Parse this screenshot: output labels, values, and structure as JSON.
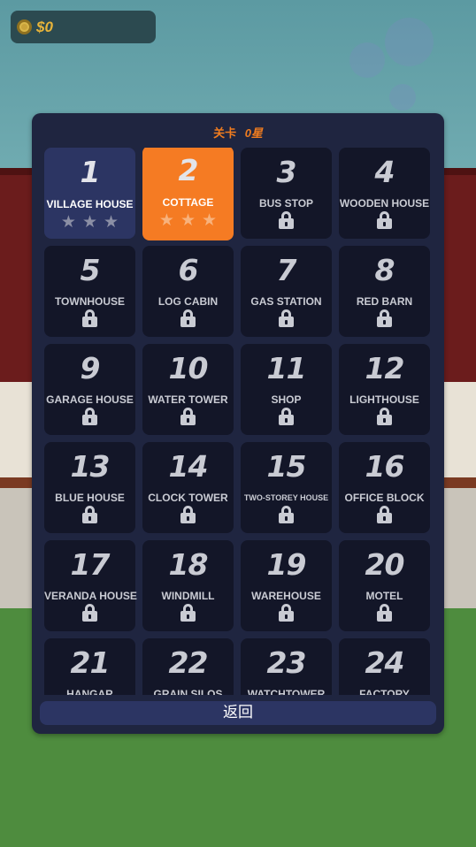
{
  "hud": {
    "coins": "$0",
    "coin_icon": "coin-icon"
  },
  "panel": {
    "title": "关卡",
    "stars_total": "0星",
    "back_label": "返回"
  },
  "colors": {
    "accent": "#f57b23",
    "panel_bg": "#1f2540",
    "tile_locked": "#131628",
    "tile_completed": "#2c3563"
  },
  "levels": [
    {
      "number": "1",
      "name": "VILLAGE HOUSE",
      "state": "completed",
      "stars": 0
    },
    {
      "number": "2",
      "name": "COTTAGE",
      "state": "current",
      "stars": 0
    },
    {
      "number": "3",
      "name": "BUS STOP",
      "state": "locked"
    },
    {
      "number": "4",
      "name": "WOODEN HOUSE",
      "state": "locked"
    },
    {
      "number": "5",
      "name": "TOWNHOUSE",
      "state": "locked"
    },
    {
      "number": "6",
      "name": "LOG CABIN",
      "state": "locked"
    },
    {
      "number": "7",
      "name": "GAS STATION",
      "state": "locked"
    },
    {
      "number": "8",
      "name": "RED BARN",
      "state": "locked"
    },
    {
      "number": "9",
      "name": "GARAGE HOUSE",
      "state": "locked"
    },
    {
      "number": "10",
      "name": "WATER TOWER",
      "state": "locked"
    },
    {
      "number": "11",
      "name": "SHOP",
      "state": "locked"
    },
    {
      "number": "12",
      "name": "LIGHTHOUSE",
      "state": "locked"
    },
    {
      "number": "13",
      "name": "BLUE HOUSE",
      "state": "locked"
    },
    {
      "number": "14",
      "name": "CLOCK TOWER",
      "state": "locked"
    },
    {
      "number": "15",
      "name": "TWO-STOREY HOUSE",
      "state": "locked"
    },
    {
      "number": "16",
      "name": "OFFICE BLOCK",
      "state": "locked"
    },
    {
      "number": "17",
      "name": "VERANDA HOUSE",
      "state": "locked"
    },
    {
      "number": "18",
      "name": "WINDMILL",
      "state": "locked"
    },
    {
      "number": "19",
      "name": "WAREHOUSE",
      "state": "locked"
    },
    {
      "number": "20",
      "name": "MOTEL",
      "state": "locked"
    },
    {
      "number": "21",
      "name": "HANGAR",
      "state": "locked"
    },
    {
      "number": "22",
      "name": "GRAIN SILOS",
      "state": "locked"
    },
    {
      "number": "23",
      "name": "WATCHTOWER",
      "state": "locked"
    },
    {
      "number": "24",
      "name": "FACTORY",
      "state": "locked"
    }
  ]
}
